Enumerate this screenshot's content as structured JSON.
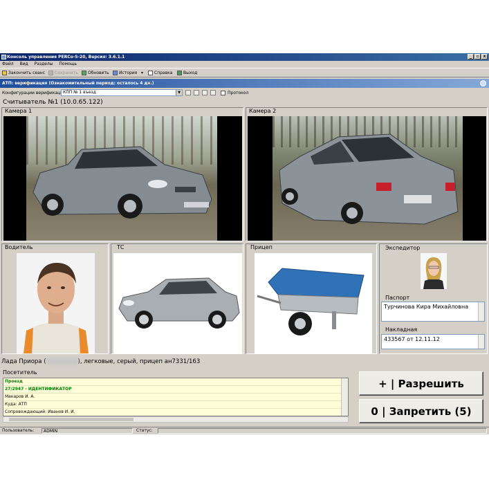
{
  "window": {
    "title": "Консоль управления PERCo-S-20, Версия: 3.6.1.1",
    "controls": [
      "_",
      "▫",
      "x"
    ]
  },
  "menu": [
    "Файл",
    "Вид",
    "Разделы",
    "Помощь"
  ],
  "toolbar": {
    "end_session": "Закончить сеанс",
    "save": "Сохранить",
    "refresh": "Обновить",
    "history": "История",
    "help": "Справка",
    "exit": "Выход"
  },
  "module_bar": {
    "title": "АТП: верификация (Ознакомительный период: осталось 4 дн.)"
  },
  "config": {
    "label": "Конфигурации верификации :",
    "value": "КПП № 1 въезд",
    "protocol_label": "Протокол"
  },
  "reader": {
    "title": "Считыватель №1 (10.0.65.122)"
  },
  "cameras": {
    "cam1": "Камера 1",
    "cam2": "Камера 2"
  },
  "panels": {
    "driver": "Водитель",
    "vehicle": "ТС",
    "trailer": "Прицеп",
    "forwarder": "Экспедитор",
    "passport_label": "Паспорт",
    "passport_value": "Турчинова Кира Михайловна",
    "waybill_label": "Накладная",
    "waybill_value": "433567 от 12.11.12"
  },
  "vehicle_line": {
    "prefix": "Лада Приора (",
    "suffix": "), легковые, серый, прицеп ан7331/163"
  },
  "visitor": {
    "title": "Посетитель",
    "rows": [
      "Проезд",
      "27/2947 - ИДЕНТИФИКАТОР",
      "Макаров И. А.",
      "Куда: АТП",
      "Сопровождающий: Иванов И. И."
    ]
  },
  "buttons": {
    "allow": "+ | Разрешить",
    "deny": "0 | Запретить (5)"
  },
  "status": {
    "user_label": "Пользователь:",
    "user_value": "ADMIN",
    "status_label": "Статус:"
  },
  "colors": {
    "title_bar": "#0a246a",
    "module_bar": "#1f4e9c",
    "visitor_green": "#008000",
    "list_bg": "#fefed8"
  }
}
